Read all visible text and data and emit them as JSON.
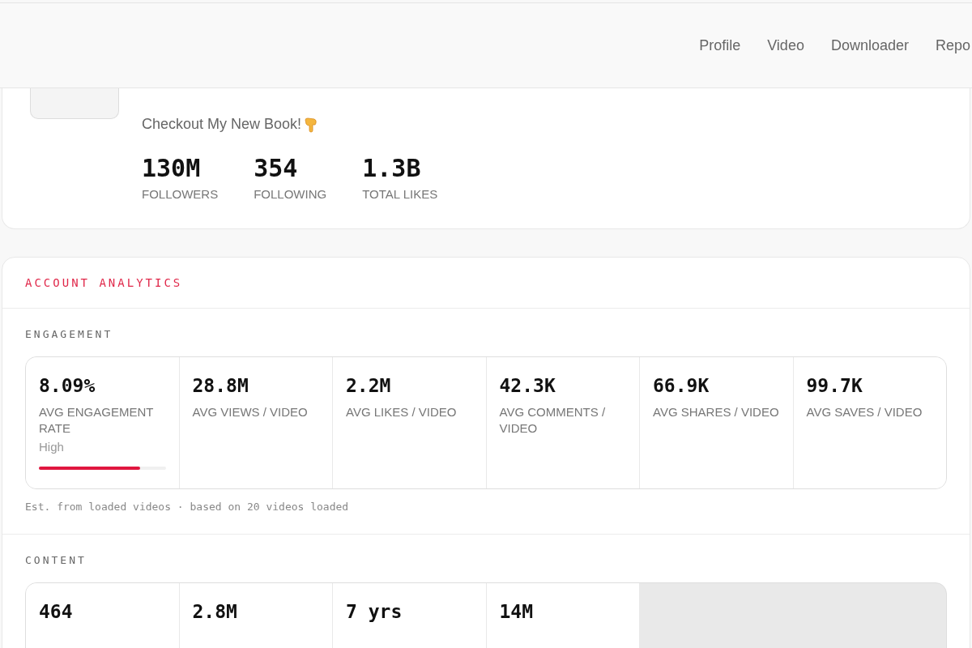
{
  "nav": [
    {
      "label": "Profile"
    },
    {
      "label": "Video"
    },
    {
      "label": "Downloader"
    },
    {
      "label": "Repo"
    }
  ],
  "profile": {
    "bio": "Checkout My New Book!",
    "stats": [
      {
        "value": "130M",
        "label": "FOLLOWERS"
      },
      {
        "value": "354",
        "label": "FOLLOWING"
      },
      {
        "value": "1.3B",
        "label": "TOTAL LIKES"
      }
    ]
  },
  "analytics": {
    "title": "ACCOUNT ANALYTICS",
    "sections": [
      {
        "title": "ENGAGEMENT",
        "metrics": [
          {
            "value": "8.09%",
            "label": "AVG ENGAGEMENT RATE",
            "rating": "High",
            "level": 0.8
          },
          {
            "value": "28.8M",
            "label": "AVG VIEWS / VIDEO"
          },
          {
            "value": "2.2M",
            "label": "AVG LIKES / VIDEO"
          },
          {
            "value": "42.3K",
            "label": "AVG COMMENTS / VIDEO"
          },
          {
            "value": "66.9K",
            "label": "AVG SHARES / VIDEO"
          },
          {
            "value": "99.7K",
            "label": "AVG SAVES / VIDEO"
          }
        ],
        "note": "Est. from loaded videos · based on 20 videos loaded"
      },
      {
        "title": "CONTENT",
        "metrics": [
          {
            "value": "464"
          },
          {
            "value": "2.8M"
          },
          {
            "value": "7 yrs"
          },
          {
            "value": "14M"
          }
        ]
      }
    ]
  }
}
